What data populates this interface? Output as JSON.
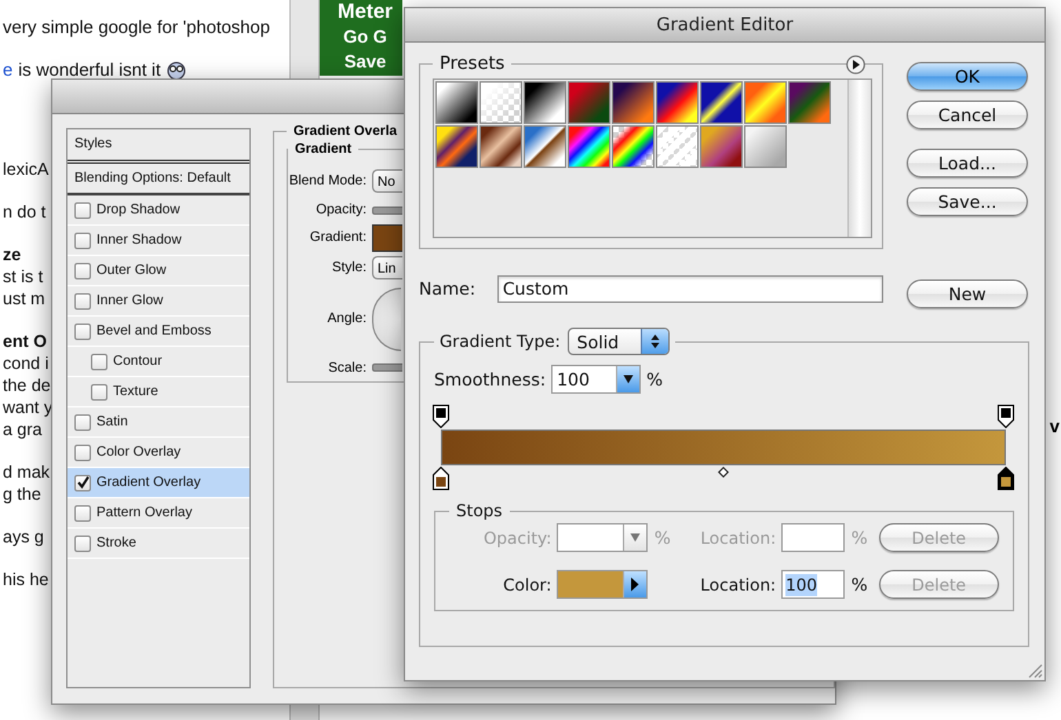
{
  "web_page": {
    "top_lines": [
      {
        "text": "very simple google for 'photoshop"
      },
      {
        "link": "e",
        "text": "is wonderful isnt it"
      }
    ],
    "paragraphs": [
      {
        "lines": [
          "lexicA"
        ]
      },
      {
        "lines": [
          "n do t"
        ]
      },
      {
        "heading": "ze",
        "lines": [
          "st is t",
          "ust m"
        ]
      },
      {
        "heading": "ent O",
        "lines": [
          "cond i",
          "the de",
          "want y",
          "a gra"
        ]
      },
      {
        "lines": [
          "d mak",
          "g the"
        ]
      },
      {
        "lines": [
          "ays g"
        ]
      },
      {
        "lines": [
          "his he"
        ]
      }
    ],
    "banner": [
      "Meter",
      "Go G",
      "Save"
    ],
    "right_fragment": "v"
  },
  "layer_style": {
    "list_header": "Styles",
    "blending_options": "Blending Options: Default",
    "effects": [
      {
        "label": "Drop Shadow",
        "checked": false,
        "selected": false
      },
      {
        "label": "Inner Shadow",
        "checked": false,
        "selected": false
      },
      {
        "label": "Outer Glow",
        "checked": false,
        "selected": false
      },
      {
        "label": "Inner Glow",
        "checked": false,
        "selected": false
      },
      {
        "label": "Bevel and Emboss",
        "checked": false,
        "selected": false,
        "children": [
          {
            "label": "Contour",
            "checked": false,
            "selected": false
          },
          {
            "label": "Texture",
            "checked": false,
            "selected": false
          }
        ]
      },
      {
        "label": "Satin",
        "checked": false,
        "selected": false
      },
      {
        "label": "Color Overlay",
        "checked": false,
        "selected": false
      },
      {
        "label": "Gradient Overlay",
        "checked": true,
        "selected": true
      },
      {
        "label": "Pattern Overlay",
        "checked": false,
        "selected": false
      },
      {
        "label": "Stroke",
        "checked": false,
        "selected": false
      }
    ],
    "panel_title": "Gradient Overla",
    "group_title": "Gradient",
    "fields": [
      {
        "label": "Blend Mode:",
        "kind": "select",
        "value": "No"
      },
      {
        "label": "Opacity:",
        "kind": "slider"
      },
      {
        "label": "Gradient:",
        "kind": "swatch",
        "color": "#7a4512"
      },
      {
        "label": "Style:",
        "kind": "select",
        "value": "Lin"
      },
      {
        "label": "Angle:",
        "kind": "dial"
      },
      {
        "label": "Scale:",
        "kind": "slider"
      }
    ]
  },
  "gradient_editor": {
    "title": "Gradient Editor",
    "presets_label": "Presets",
    "name_label": "Name:",
    "name_value": "Custom",
    "buttons": [
      {
        "label": "OK",
        "default": true
      },
      {
        "label": "Cancel",
        "default": false
      },
      {
        "label": "Load...",
        "default": false
      },
      {
        "label": "Save...",
        "default": false
      }
    ],
    "new_button": "New",
    "gradient_type_label": "Gradient Type:",
    "gradient_type": "Solid",
    "smoothness_label": "Smoothness:",
    "smoothness": "100",
    "smoothness_unit": "%",
    "opacity_stops": [
      {
        "level": 0,
        "selected": false
      },
      {
        "level": 1,
        "selected": false
      }
    ],
    "color_stops": [
      {
        "level": 0,
        "color": "#7a4512",
        "selected": false
      },
      {
        "level": 1,
        "color": "#c4973c",
        "selected": true
      }
    ],
    "midpoint": {
      "level": 0.5
    },
    "stops_label": "Stops",
    "stop_rows": [
      {
        "kind": "opacity",
        "disabled": true,
        "label": "Opacity:",
        "unit": "%",
        "location_label": "Location:",
        "location_unit": "%",
        "delete": "Delete",
        "delete_disabled": true
      },
      {
        "kind": "color",
        "disabled": false,
        "label": "Color:",
        "color": "#c4973c",
        "location_label": "Location:",
        "location": "100",
        "location_highlighted": true,
        "location_unit": "%",
        "delete": "Delete",
        "delete_disabled": true
      }
    ]
  }
}
